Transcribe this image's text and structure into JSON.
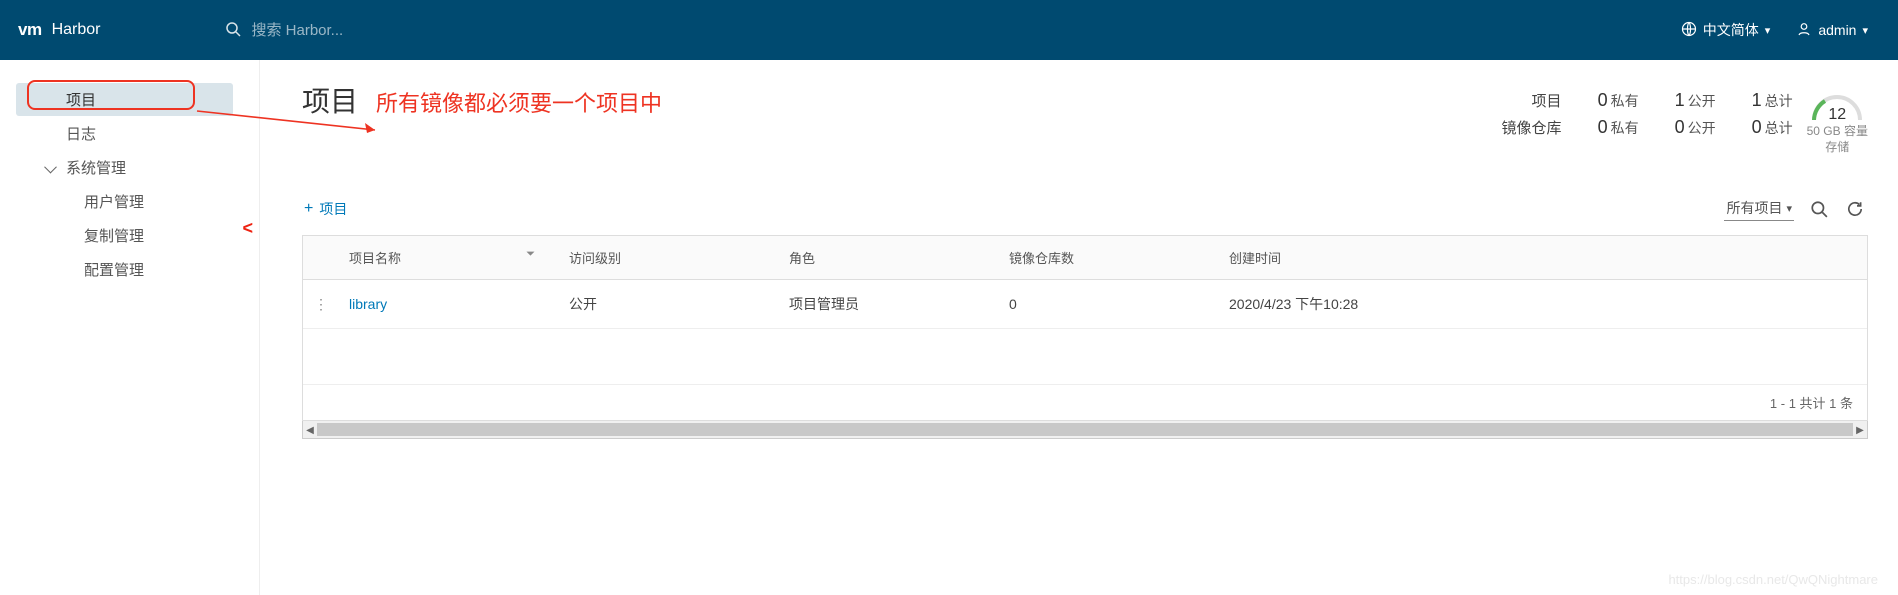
{
  "header": {
    "brand_short": "vm",
    "brand_name": "Harbor",
    "search_placeholder": "搜索 Harbor...",
    "language": "中文简体",
    "user": "admin"
  },
  "sidebar": {
    "items": [
      {
        "label": "项目",
        "active": true
      },
      {
        "label": "日志"
      },
      {
        "label": "系统管理",
        "parent": true
      },
      {
        "label": "用户管理",
        "sub": true
      },
      {
        "label": "复制管理",
        "sub": true
      },
      {
        "label": "配置管理",
        "sub": true
      }
    ],
    "collapse_glyph": "<"
  },
  "annotation": {
    "text": "所有镜像都必须要一个项目中"
  },
  "page": {
    "title": "项目"
  },
  "summary": {
    "row_labels": [
      "项目",
      "镜像仓库"
    ],
    "cols": [
      {
        "count": "0",
        "suffix": "私有"
      },
      {
        "count": "1",
        "suffix": "公开"
      },
      {
        "count": "1",
        "suffix": "总计"
      }
    ],
    "row2_cols": [
      {
        "count": "0",
        "suffix": "私有"
      },
      {
        "count": "0",
        "suffix": "公开"
      },
      {
        "count": "0",
        "suffix": "总计"
      }
    ],
    "gauge": {
      "value": "12",
      "unit": "50 GB",
      "caption_1": "容量",
      "caption_2": "存储"
    }
  },
  "toolbar": {
    "add_label": "项目",
    "filter_label": "所有项目"
  },
  "table": {
    "headers": [
      "项目名称",
      "访问级别",
      "角色",
      "镜像仓库数",
      "创建时间"
    ],
    "rows": [
      {
        "name": "library",
        "access": "公开",
        "role": "项目管理员",
        "repos": "0",
        "created": "2020/4/23 下午10:28"
      }
    ],
    "footer": "1 - 1 共计 1 条"
  },
  "watermark": "https://blog.csdn.net/QwQNightmare"
}
